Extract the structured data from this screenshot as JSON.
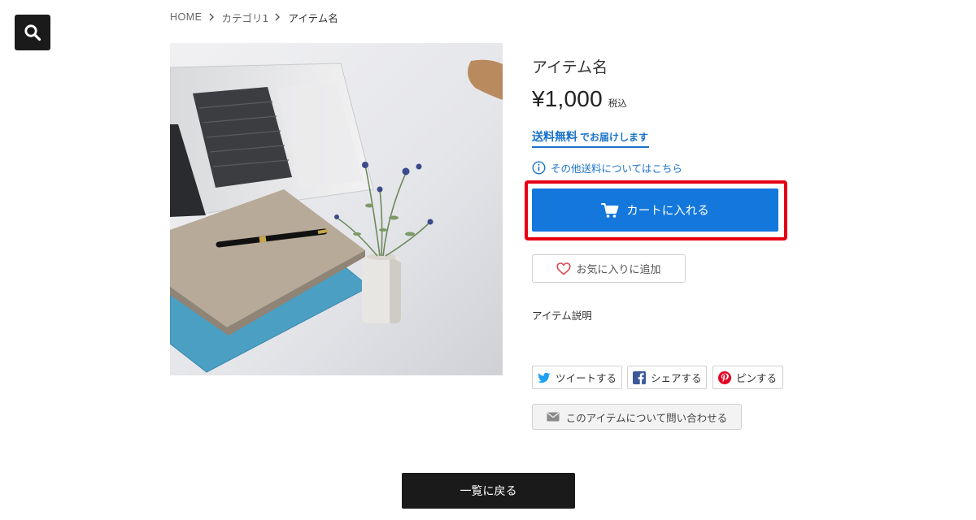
{
  "breadcrumb": {
    "items": [
      "HOME",
      "カテゴリ1",
      "アイテム名"
    ]
  },
  "search": {
    "icon": "search-icon"
  },
  "product": {
    "title": "アイテム名",
    "price": "¥1,000",
    "tax_label": "税込",
    "free_shipping_strong": "送料無料",
    "free_shipping_rest": "でお届けします",
    "shipping_link": "その他送料についてはこちら",
    "add_to_cart": "カートに入れる",
    "favorite": "お気に入りに追加",
    "description": "アイテム説明",
    "contact": "このアイテムについて問い合わせる"
  },
  "share": {
    "twitter": "ツイートする",
    "facebook": "シェアする",
    "pinterest": "ピンする"
  },
  "back_button": "一覧に戻る",
  "colors": {
    "accent_blue": "#1477db",
    "link_blue": "#1a73c9",
    "highlight_red": "#e60012",
    "dark": "#1a1a1a",
    "twitter": "#1da1f2",
    "facebook": "#3b5998",
    "pinterest": "#e60023"
  }
}
